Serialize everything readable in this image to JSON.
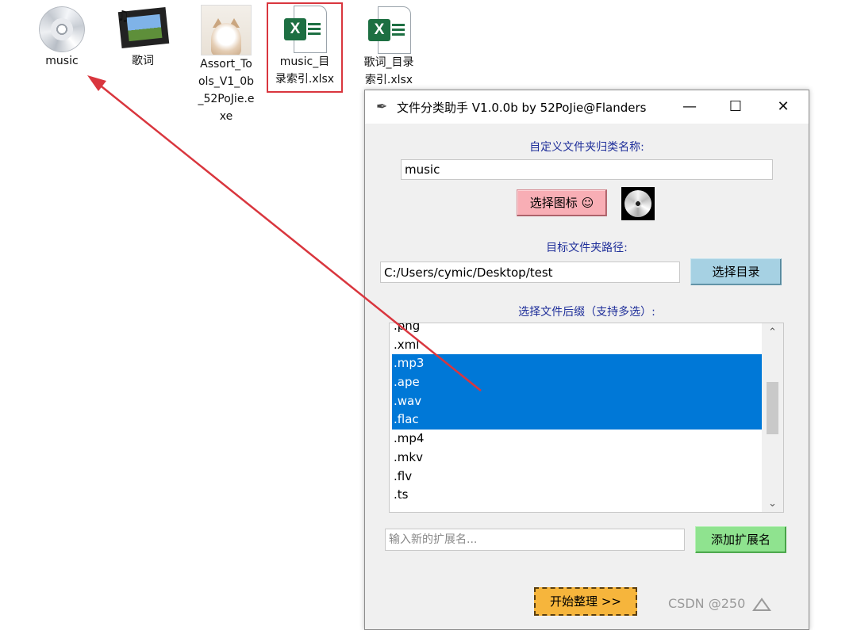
{
  "desktop": {
    "icons": [
      {
        "label": "music"
      },
      {
        "label": "歌词"
      },
      {
        "label": "Assort_To\nols_V1_0b\n_52PoJie.e\nxe"
      },
      {
        "label": "music_目\n录索引.xlsx"
      },
      {
        "label": "歌词_目录\n索引.xlsx"
      }
    ]
  },
  "window": {
    "title": "文件分类助手 V1.0.0b by 52PoJie@Flanders",
    "controls": {
      "minimize": "—",
      "maximize": "☐",
      "close": "✕"
    },
    "folder_name_label": "自定义文件夹归类名称:",
    "folder_name_value": "music",
    "choose_icon_label": "选择图标 ☺",
    "target_path_label": "目标文件夹路径:",
    "target_path_value": "C:/Users/cymic/Desktop/test",
    "choose_dir_label": "选择目录",
    "extensions_label": "选择文件后缀（支持多选）:",
    "extensions": [
      {
        "text": ".png",
        "selected": false
      },
      {
        "text": ".xml",
        "selected": false
      },
      {
        "text": ".mp3",
        "selected": true
      },
      {
        "text": ".ape",
        "selected": true
      },
      {
        "text": ".wav",
        "selected": true
      },
      {
        "text": ".flac",
        "selected": true
      },
      {
        "text": ".mp4",
        "selected": false
      },
      {
        "text": ".mkv",
        "selected": false
      },
      {
        "text": ".flv",
        "selected": false
      },
      {
        "text": ".ts",
        "selected": false
      }
    ],
    "new_ext_placeholder": "输入新的扩展名...",
    "add_ext_label": "添加扩展名",
    "start_label": "开始整理 >>"
  },
  "watermark": "CSDN @250",
  "colors": {
    "selection": "#0078d7",
    "label_text": "#1f2f9a",
    "annotation_arrow": "#d9363e",
    "choose_icon_button": "#f8aeb5",
    "choose_dir_button": "#a6d1e3",
    "add_ext_button": "#8fe38f",
    "start_button": "#f6b53c"
  }
}
